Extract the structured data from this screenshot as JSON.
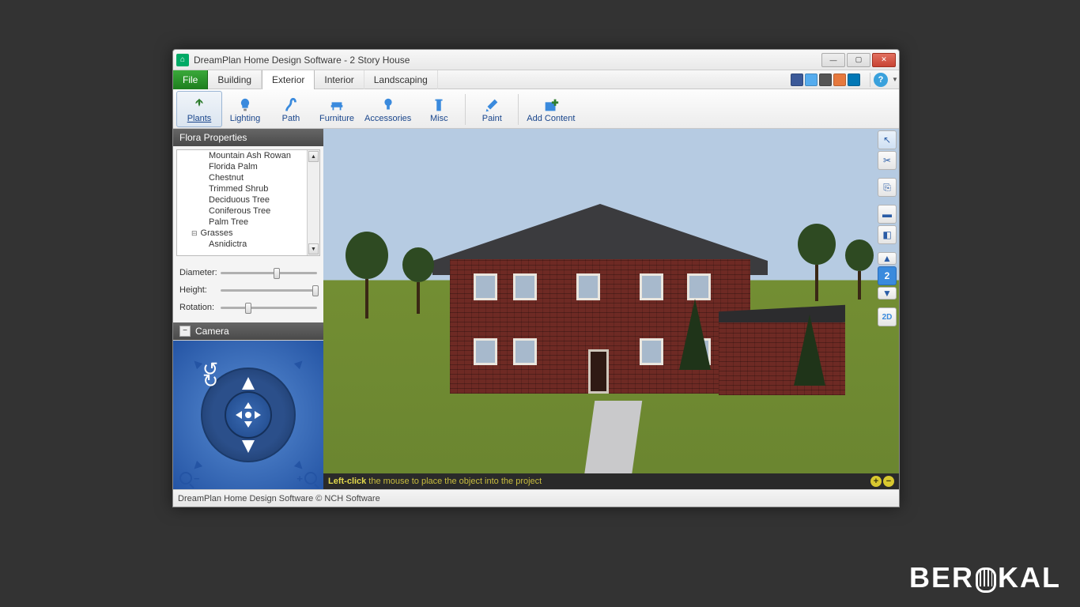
{
  "window": {
    "title": "DreamPlan Home Design Software - 2 Story House",
    "minimize": "—",
    "maximize": "▢",
    "close": "✕"
  },
  "menu": {
    "file": "File",
    "tabs": [
      "Building",
      "Exterior",
      "Interior",
      "Landscaping"
    ],
    "active_index": 1
  },
  "social": [
    "facebook-icon",
    "twitter-icon",
    "instagram-icon",
    "download-icon",
    "linkedin-icon"
  ],
  "help": "?",
  "toolbar": {
    "items": [
      {
        "label": "Plants",
        "icon": "plant-icon",
        "selected": true
      },
      {
        "label": "Lighting",
        "icon": "bulb-icon"
      },
      {
        "label": "Path",
        "icon": "path-icon"
      },
      {
        "label": "Furniture",
        "icon": "furniture-icon"
      },
      {
        "label": "Accessories",
        "icon": "accessories-icon"
      },
      {
        "label": "Misc",
        "icon": "misc-icon"
      }
    ],
    "paint": "Paint",
    "add_content": "Add Content"
  },
  "flora_panel": {
    "title": "Flora Properties",
    "items": [
      "Mountain Ash Rowan",
      "Florida Palm",
      "Chestnut",
      "Trimmed Shrub",
      "Deciduous Tree",
      "Coniferous Tree",
      "Palm Tree"
    ],
    "category": "Grasses",
    "subitem": "Asnidictra"
  },
  "sliders": {
    "diameter": {
      "label": "Diameter:",
      "value": 55
    },
    "height": {
      "label": "Height:",
      "value": 95
    },
    "rotation": {
      "label": "Rotation:",
      "value": 25
    }
  },
  "camera": {
    "title": "Camera"
  },
  "right_tools": {
    "floor_number": "2",
    "view2d": "2D"
  },
  "hint": {
    "prefix": "Left-click",
    "text": " the mouse to place the object into the project"
  },
  "statusbar": "DreamPlan Home Design Software © NCH Software",
  "watermark": {
    "pre": "BER",
    "post": "KAL"
  }
}
